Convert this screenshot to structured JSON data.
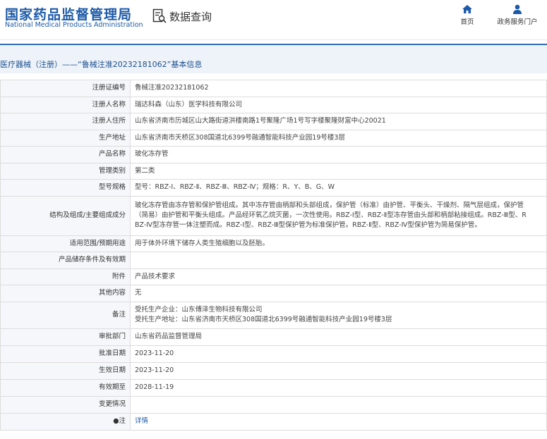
{
  "header": {
    "logo_cn": "国家药品监督管理局",
    "logo_en": "National Medical Products Administration",
    "query_label": "数据查询",
    "nav_home": "首页",
    "nav_gov": "政务服务门户"
  },
  "breadcrumb": "医疗器械（注册）——“鲁械注准20232181062”基本信息",
  "colors": {
    "brand": "#1d5aa8",
    "label_bg": "#f5f7fa",
    "crumb_bg": "#eef3f9"
  },
  "rows": [
    {
      "label": "注册证编号",
      "value": "鲁械注准20232181062"
    },
    {
      "label": "注册人名称",
      "value": "瑞达科森（山东）医学科技有限公司"
    },
    {
      "label": "注册人住所",
      "value": "山东省济南市历城区山大路街道洪楼南路1号聚隆广场1号写字楼聚隆财富中心20021"
    },
    {
      "label": "生产地址",
      "value": "山东省济南市天桥区308国道北6399号融通智能科技产业园19号楼3层"
    },
    {
      "label": "产品名称",
      "value": "玻化冻存管"
    },
    {
      "label": "管理类别",
      "value": "第二类"
    },
    {
      "label": "型号规格",
      "value": "型号：RBZ-Ⅰ、RBZ-Ⅱ、RBZ-Ⅲ、RBZ-Ⅳ；规格：R、Y、B、G、W"
    },
    {
      "label": "结构及组成/主要组成成分",
      "lines": [
        "玻化冻存管由冻存管和保护管组成。其中冻存管由柄部和头部组成，保护管（标准）由护管、平衡头、干燥剂、隔气层组成，保护管",
        "（简易）由护管和平衡头组成。产品经环氧乙烷灭菌，一次性使用。RBZ-Ⅰ型、RBZ-Ⅱ型冻存管由头部和柄部粘接组成。RBZ-Ⅲ型、R",
        "BZ-Ⅳ型冻存管一体注塑而成。RBZ-Ⅰ型、RBZ-Ⅲ型保护管为标准保护管。RBZ-Ⅱ型、RBZ-Ⅳ型保护管为简易保护管。"
      ]
    },
    {
      "label": "适用范围/预期用途",
      "value": "用于体外环境下储存人类生殖细胞以及胚胎。"
    },
    {
      "label": "产品储存条件及有效期",
      "value": ""
    },
    {
      "label": "附件",
      "value": "产品技术要求"
    },
    {
      "label": "其他内容",
      "value": "无"
    },
    {
      "label": "备注",
      "lines": [
        "受托生产企业：山东傅泽生物科技有限公司",
        "受托生产地址：山东省济南市天桥区308国道北6399号融通智能科技产业园19号楼3层"
      ]
    },
    {
      "label": "审批部门",
      "value": "山东省药品监督管理局"
    },
    {
      "label": "批准日期",
      "value": "2023-11-20"
    },
    {
      "label": "生效日期",
      "value": "2023-11-20"
    },
    {
      "label": "有效期至",
      "value": "2028-11-19"
    },
    {
      "label": "变更情况",
      "value": ""
    },
    {
      "label": "●注",
      "value": "详情"
    }
  ]
}
